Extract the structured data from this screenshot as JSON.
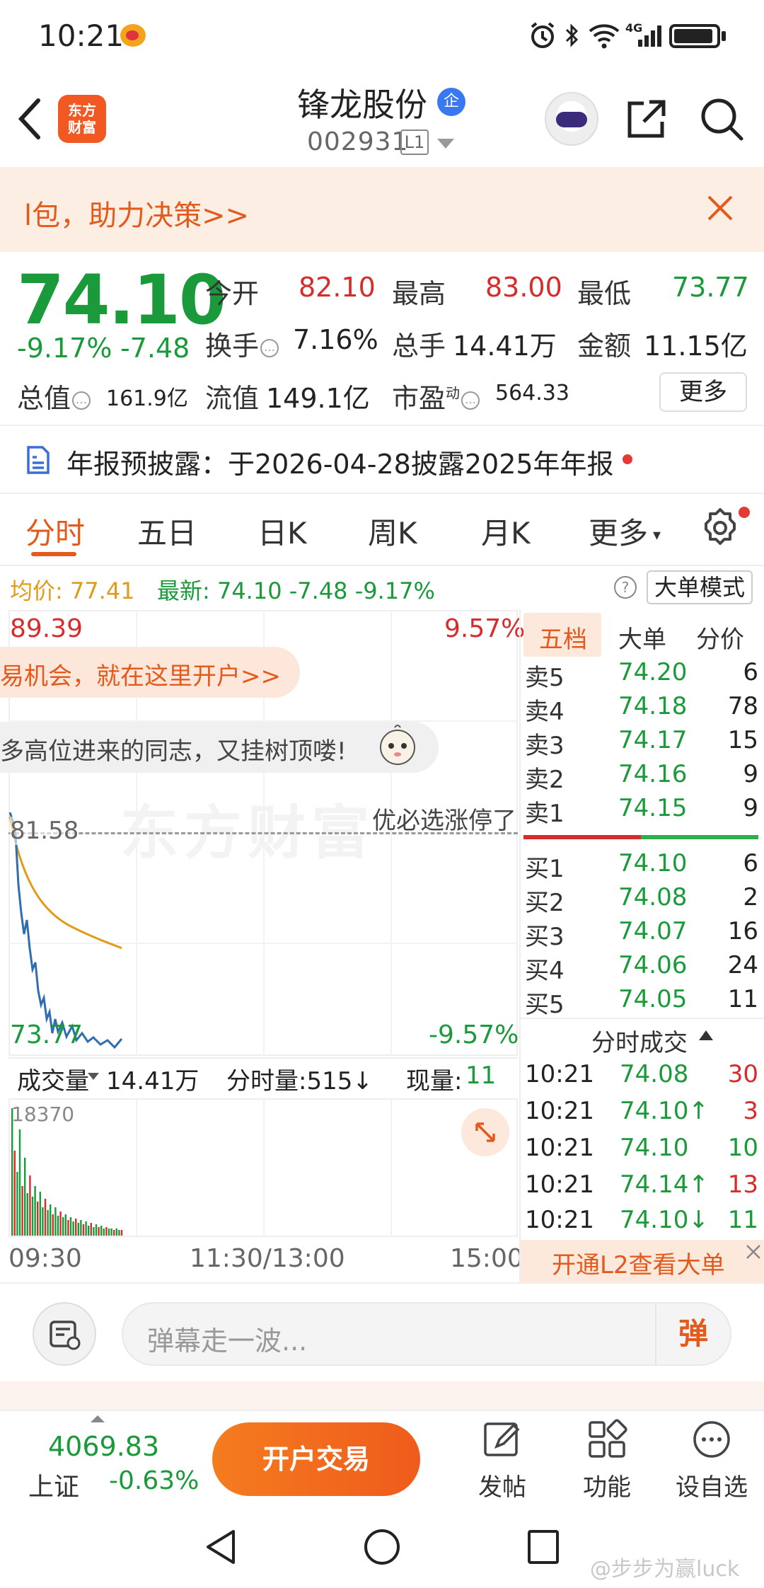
{
  "status_bar": {
    "time": "10:21",
    "network": "4G"
  },
  "header": {
    "brand_logo_line1": "东方",
    "brand_logo_line2": "财富",
    "stock_name": "锋龙股份",
    "ent_badge": "企",
    "stock_code": "002931",
    "level": "L1"
  },
  "banner": {
    "text": "l包，助力决策>>"
  },
  "quote": {
    "price": "74.10",
    "pct_change": "-9.17%",
    "abs_change": "-7.48",
    "open_label": "今开",
    "open": "82.10",
    "high_label": "最高",
    "high": "83.00",
    "low_label": "最低",
    "low": "73.77",
    "turnover_label": "换手",
    "turnover": "7.16%",
    "volume_label": "总手",
    "volume": "14.41万",
    "amount_label": "金额",
    "amount": "11.15亿",
    "mktcap_label": "总值",
    "mktcap": "161.9亿",
    "float_cap_label": "流值",
    "float_cap": "149.1亿",
    "pe_label": "市盈",
    "pe_sup": "动",
    "pe": "564.33",
    "more_button": "更多"
  },
  "notice": {
    "text": "年报预披露：于2026-04-28披露2025年年报"
  },
  "tabs": [
    "分时",
    "五日",
    "日K",
    "周K",
    "月K",
    "更多"
  ],
  "summary": {
    "avg_label": "均价: 77.41",
    "latest_label": "最新: 74.10  -7.48  -9.17%",
    "big_order_button": "大单模式"
  },
  "chart": {
    "max_price": "89.39",
    "max_pct": "9.57%",
    "min_price": "73.77",
    "min_pct": "-9.57%",
    "prev_close": "81.58",
    "watermark": "东方财富",
    "promo_text": "易机会，就在这里开户>>",
    "danmu_text": "多高位进来的同志，又挂树顶喽!",
    "danmu_right": "优必选涨停了"
  },
  "volume": {
    "select_label": "成交量",
    "total": "14.41万",
    "minute": "分时量:515↓",
    "now_label": "现量:",
    "now_value": "11",
    "max_label": "18370"
  },
  "time_axis": {
    "start": "09:30",
    "mid": "11:30/13:00",
    "end": "15:00"
  },
  "order_book": {
    "tabs": [
      "五档",
      "大单",
      "分价"
    ],
    "asks": [
      {
        "label": "卖5",
        "price": "74.20",
        "vol": "6"
      },
      {
        "label": "卖4",
        "price": "74.18",
        "vol": "78"
      },
      {
        "label": "卖3",
        "price": "74.17",
        "vol": "15"
      },
      {
        "label": "卖2",
        "price": "74.16",
        "vol": "9"
      },
      {
        "label": "卖1",
        "price": "74.15",
        "vol": "9"
      }
    ],
    "bids": [
      {
        "label": "买1",
        "price": "74.10",
        "vol": "6"
      },
      {
        "label": "买2",
        "price": "74.08",
        "vol": "2"
      },
      {
        "label": "买3",
        "price": "74.07",
        "vol": "16"
      },
      {
        "label": "买4",
        "price": "74.06",
        "vol": "24"
      },
      {
        "label": "买5",
        "price": "74.05",
        "vol": "11"
      }
    ]
  },
  "ticks": {
    "header": "分时成交",
    "rows": [
      {
        "time": "10:21",
        "price": "74.08",
        "vol": "30",
        "vol_color": "#d62c2c"
      },
      {
        "time": "10:21",
        "price": "74.10↑",
        "vol": "3",
        "vol_color": "#d62c2c"
      },
      {
        "time": "10:21",
        "price": "74.10",
        "vol": "10",
        "vol_color": "#1a9a3a"
      },
      {
        "time": "10:21",
        "price": "74.14↑",
        "vol": "13",
        "vol_color": "#d62c2c"
      },
      {
        "time": "10:21",
        "price": "74.10↓",
        "vol": "11",
        "vol_color": "#1a9a3a"
      }
    ],
    "l2_banner": "开通L2查看大单"
  },
  "comment": {
    "placeholder": "弹幕走一波...",
    "send_label": "弹"
  },
  "bottom_bar": {
    "index_value": "4069.83",
    "index_name": "上证",
    "index_change": "-0.63%",
    "trade_button": "开户交易",
    "post_label": "发帖",
    "func_label": "功能",
    "watch_label": "设自选"
  },
  "watermark_bottom": "@步步为赢luck",
  "colors": {
    "up": "#d62c2c",
    "down": "#1a9a3a",
    "accent": "#e35a1c",
    "avg_line": "#e39a1a",
    "price_line": "#2f6db0"
  }
}
